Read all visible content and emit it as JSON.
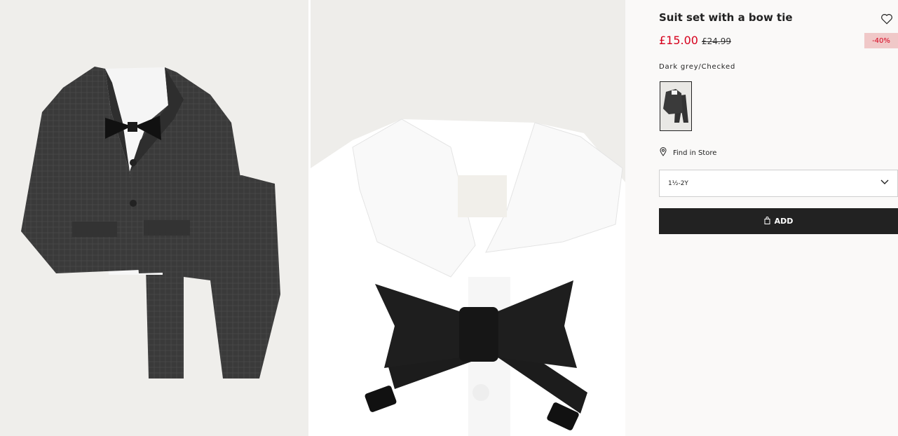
{
  "product": {
    "title": "Suit set with a bow tie",
    "price": "£15.00",
    "old_price": "£24.99",
    "discount": "-40%",
    "color_name": "Dark grey/Checked"
  },
  "store": {
    "label": "Find in Store"
  },
  "size_select": {
    "value": "1½-2Y"
  },
  "add_button": {
    "label": "ADD"
  },
  "icons": [
    "heart-icon",
    "location-pin-icon",
    "chevron-down-icon",
    "shopping-bag-icon"
  ],
  "colors": {
    "sale_red": "#d6001c",
    "badge_bg": "#f0c8c8",
    "button_bg": "#222222"
  }
}
